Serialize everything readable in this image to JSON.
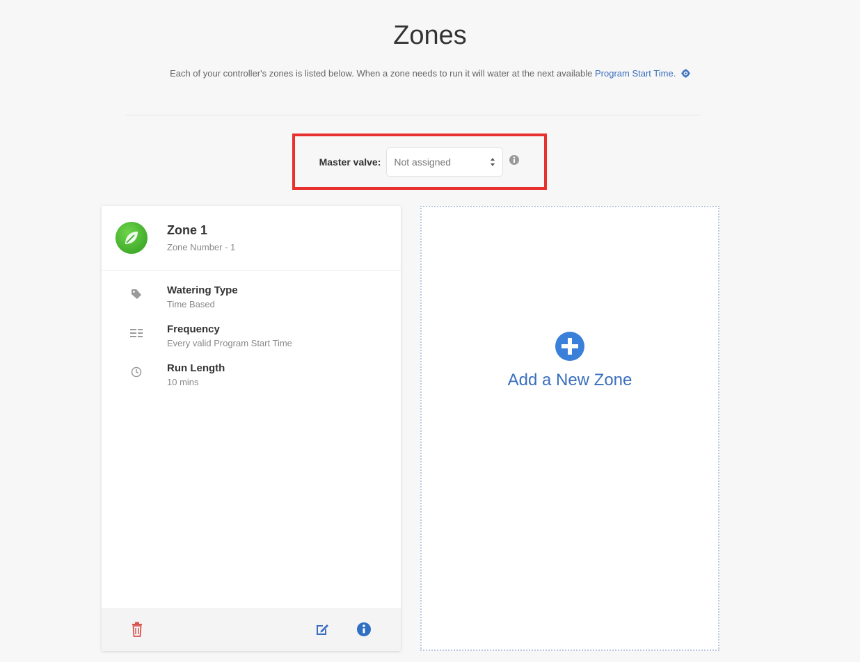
{
  "page": {
    "title": "Zones",
    "intro_text": "Each of your controller's zones is listed below. When a zone needs to run it will water at the next available",
    "intro_link": "Program Start Time.",
    "gear_icon": "gear-icon"
  },
  "master_valve": {
    "label": "Master valve:",
    "selected": "Not assigned",
    "info_icon": "info-icon"
  },
  "zone_card": {
    "title": "Zone 1",
    "subtitle": "Zone Number - 1",
    "avatar_icon": "leaf-icon",
    "avatar_color": "#3aae2a",
    "details": [
      {
        "icon": "tag-icon",
        "title": "Watering Type",
        "value": "Time Based"
      },
      {
        "icon": "list-icon",
        "title": "Frequency",
        "value": "Every valid Program Start Time"
      },
      {
        "icon": "clock-icon",
        "title": "Run Length",
        "value": "10 mins"
      }
    ],
    "footer": {
      "delete_icon": "trash-icon",
      "edit_icon": "edit-icon",
      "info_icon": "info-icon"
    }
  },
  "add_zone": {
    "label": "Add a New Zone",
    "icon": "plus-circle-icon",
    "accent": "#3a7fd9"
  },
  "colors": {
    "highlight": "#e8302e",
    "link": "#3a6fbf",
    "delete": "#d9534f"
  }
}
